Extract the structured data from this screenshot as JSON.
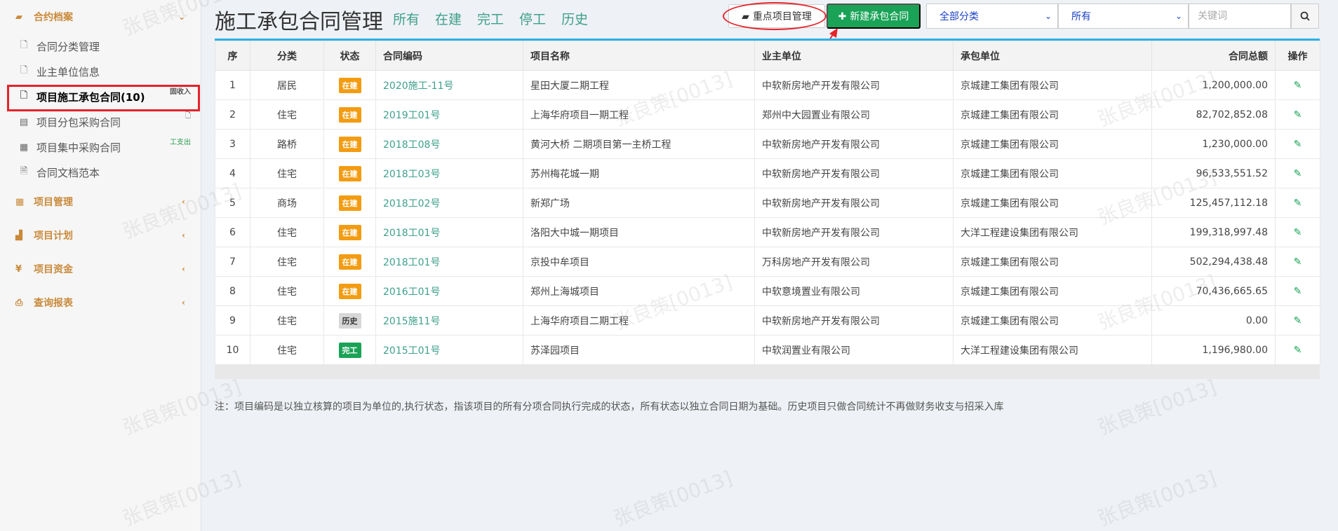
{
  "sidebar": {
    "top_group": {
      "label": "合约档案",
      "icon": "book-icon"
    },
    "items": [
      {
        "label": "合同分类管理",
        "icon": "file-icon",
        "badge": ""
      },
      {
        "label": "业主单位信息",
        "icon": "file-icon",
        "badge": ""
      },
      {
        "label": "项目施工承包合同(10)",
        "icon": "file-icon",
        "badge": "固收入"
      },
      {
        "label": "项目分包采购合同",
        "icon": "briefcase-icon",
        "badge": ""
      },
      {
        "label": "项目集中采购合同",
        "icon": "calculator-icon",
        "badge": "工支出"
      },
      {
        "label": "合同文档范本",
        "icon": "word-file-icon",
        "badge": ""
      }
    ],
    "groups": [
      {
        "label": "项目管理",
        "icon": "calendar-icon"
      },
      {
        "label": "项目计划",
        "icon": "chart-icon"
      },
      {
        "label": "项目资金",
        "icon": "yen-icon"
      },
      {
        "label": "查询报表",
        "icon": "print-icon"
      }
    ]
  },
  "header": {
    "title": "施工承包合同管理",
    "tabs": [
      "所有",
      "在建",
      "完工",
      "停工",
      "历史"
    ],
    "key_project_button": "重点项目管理",
    "new_contract_button": "新建承包合同",
    "category_select": "全部分类",
    "status_select": "所有",
    "keyword_placeholder": "关键词"
  },
  "table": {
    "columns": [
      "序",
      "分类",
      "状态",
      "合同编码",
      "项目名称",
      "业主单位",
      "承包单位",
      "合同总额",
      "操作"
    ],
    "rows": [
      {
        "no": "1",
        "category": "居民",
        "status": "在建",
        "code": "2020施工-11号",
        "name": "星田大厦二期工程",
        "owner": "中软新房地产开发有限公司",
        "contractor": "京城建工集团有限公司",
        "amount": "1,200,000.00"
      },
      {
        "no": "2",
        "category": "住宅",
        "status": "在建",
        "code": "2019工01号",
        "name": "上海华府项目一期工程",
        "owner": "郑州中大园置业有限公司",
        "contractor": "京城建工集团有限公司",
        "amount": "82,702,852.08"
      },
      {
        "no": "3",
        "category": "路桥",
        "status": "在建",
        "code": "2018工08号",
        "name": "黄河大桥 二期项目第一主桥工程",
        "owner": "中软新房地产开发有限公司",
        "contractor": "京城建工集团有限公司",
        "amount": "1,230,000.00"
      },
      {
        "no": "4",
        "category": "住宅",
        "status": "在建",
        "code": "2018工03号",
        "name": "苏州梅花城一期",
        "owner": "中软新房地产开发有限公司",
        "contractor": "京城建工集团有限公司",
        "amount": "96,533,551.52"
      },
      {
        "no": "5",
        "category": "商场",
        "status": "在建",
        "code": "2018工02号",
        "name": "新郑广场",
        "owner": "中软新房地产开发有限公司",
        "contractor": "京城建工集团有限公司",
        "amount": "125,457,112.18"
      },
      {
        "no": "6",
        "category": "住宅",
        "status": "在建",
        "code": "2018工01号",
        "name": "洛阳大中城一期项目",
        "owner": "中软新房地产开发有限公司",
        "contractor": "大洋工程建设集团有限公司",
        "amount": "199,318,997.48"
      },
      {
        "no": "7",
        "category": "住宅",
        "status": "在建",
        "code": "2018工01号",
        "name": "京投中牟项目",
        "owner": "万科房地产开发有限公司",
        "contractor": "京城建工集团有限公司",
        "amount": "502,294,438.48"
      },
      {
        "no": "8",
        "category": "住宅",
        "status": "在建",
        "code": "2016工01号",
        "name": "郑州上海城项目",
        "owner": "中软意境置业有限公司",
        "contractor": "京城建工集团有限公司",
        "amount": "70,436,665.65"
      },
      {
        "no": "9",
        "category": "住宅",
        "status": "历史",
        "code": "2015施11号",
        "name": "上海华府项目二期工程",
        "owner": "中软新房地产开发有限公司",
        "contractor": "京城建工集团有限公司",
        "amount": "0.00"
      },
      {
        "no": "10",
        "category": "住宅",
        "status": "完工",
        "code": "2015工01号",
        "name": "苏泽园项目",
        "owner": "中软润置业有限公司",
        "contractor": "大洋工程建设集团有限公司",
        "amount": "1,196,980.00"
      }
    ]
  },
  "note": "注：项目编码是以独立核算的项目为单位的,执行状态，指该项目的所有分项合同执行完成的状态，所有状态以独立合同日期为基础。历史项目只做合同统计不再做财务收支与招采入库",
  "watermark": "张良策[0013]",
  "colors": {
    "accent_green": "#1aa357",
    "status_building": "#f39c12",
    "link_teal": "#3fa08c",
    "highlight_red": "#e5232a",
    "table_top": "#2ab3e6"
  }
}
